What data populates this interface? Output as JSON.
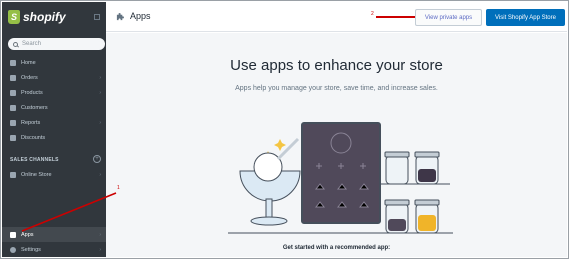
{
  "logo": {
    "mark": "S",
    "text": "shopify"
  },
  "search": {
    "placeholder": "Search"
  },
  "nav": [
    {
      "label": "Home",
      "icon": "home-icon"
    },
    {
      "label": "Orders",
      "icon": "orders-icon",
      "chevron": "›"
    },
    {
      "label": "Products",
      "icon": "tag-icon",
      "chevron": "›"
    },
    {
      "label": "Customers",
      "icon": "customers-icon"
    },
    {
      "label": "Reports",
      "icon": "reports-icon",
      "chevron": "›"
    },
    {
      "label": "Discounts",
      "icon": "discounts-icon"
    }
  ],
  "sales_channels": {
    "header": "SALES CHANNELS",
    "add_symbol": "+",
    "items": [
      {
        "label": "Online Store",
        "chevron": "›"
      }
    ]
  },
  "bottom_nav": [
    {
      "label": "Apps",
      "active": true,
      "icon": "puzzle-icon",
      "chevron": "›"
    },
    {
      "label": "Settings",
      "icon": "gear-icon",
      "chevron": "›"
    }
  ],
  "header": {
    "title": "Apps",
    "private_apps_label": "View private apps",
    "app_store_label": "Visit Shopify App Store"
  },
  "main": {
    "headline": "Use apps to enhance your store",
    "subline": "Apps help you manage your store, save time, and increase sales.",
    "get_started": "Get started with a recommended app:"
  },
  "annotations": {
    "marker_1": "1",
    "marker_2": "2",
    "color": "#cc0000"
  },
  "colors": {
    "sidebar": "#31373d",
    "primary_button": "#006fbb",
    "content_bg": "#f4f6f8",
    "logo_green": "#95bf47"
  }
}
